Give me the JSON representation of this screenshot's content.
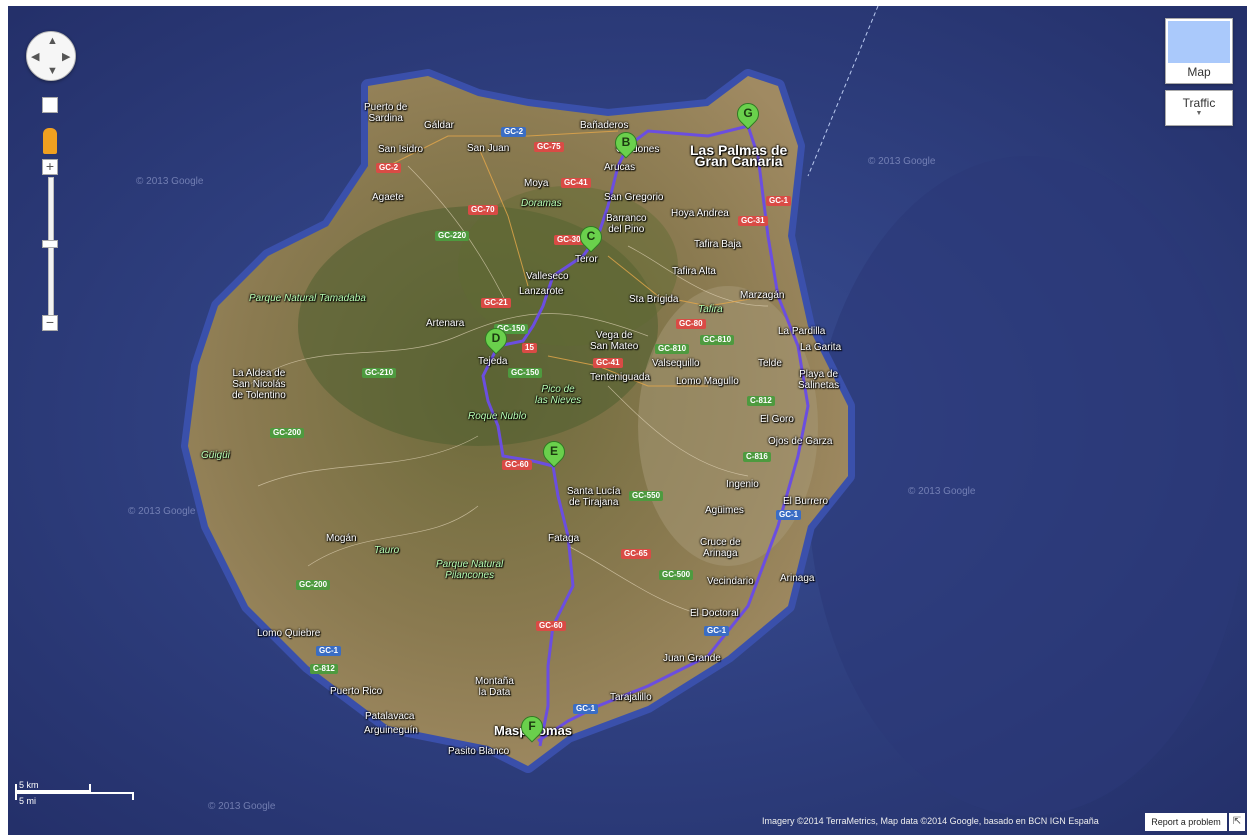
{
  "map_controls": {
    "map_type_label": "Map",
    "traffic_label": "Traffic",
    "zoom_in": "+",
    "zoom_out": "−"
  },
  "scale": {
    "km": "5 km",
    "mi": "5 mi"
  },
  "attribution": "Imagery ©2014 TerraMetrics, Map data ©2014 Google, basado en BCN IGN España",
  "report_label": "Report a problem",
  "watermarks": [
    "© 2013 Google"
  ],
  "waypoints": [
    "B",
    "C",
    "D",
    "E",
    "F",
    "G"
  ],
  "places": {
    "puerto_sardina": "Puerto de\nSardina",
    "galdar": "Gáldar",
    "san_isidro": "San Isidro",
    "san_juan": "San Juan",
    "banaderos": "Bañaderos",
    "cardones": "Cardones",
    "las_palmas": "Las Palmas de\nGran Canaria",
    "arucas": "Arucas",
    "moya": "Moya",
    "doramas": "Doramas",
    "san_gregorio": "San Gregorio",
    "hoya_andrea": "Hoya Andrea",
    "barranco": "Barranco\ndel Pino",
    "agaete": "Agaete",
    "tafira_baja": "Tafira Baja",
    "teror": "Teror",
    "tafira_alta": "Tafira Alta",
    "valleseco": "Valleseco",
    "lanzarote": "Lanzarote",
    "marzagan": "Marzagán",
    "sta_brigida": "Sta Brígida",
    "tafira": "Tafira",
    "tamadaba": "Parque Natural Tamadaba",
    "artenara": "Artenara",
    "la_pardilla": "La Pardilla",
    "vega": "Vega de\nSan Mateo",
    "la_garita": "La Garita",
    "tejeda": "Tejeda",
    "valsequillo": "Valsequillo",
    "telde": "Telde",
    "la_aldea": "La Aldea de\nSan Nicolás\nde Tolentino",
    "tenteniguada": "Tenteniguada",
    "lomo_magullo": "Lomo Magullo",
    "playa": "Playa de\nSalinetas",
    "pico": "Pico de\nlas Nieves",
    "roque": "Roque Nublo",
    "el_goro": "El Goro",
    "ojos": "Ojos de Garza",
    "guigui": "Güigüi",
    "ingenio": "Ingenio",
    "santa_lucia": "Santa Lucía\nde Tirajana",
    "el_burrero": "El Burrero",
    "aguimes": "Agüimes",
    "mogan": "Mogán",
    "tauro": "Tauro",
    "fataga": "Fataga",
    "cruce": "Cruce de\nArinaga",
    "pilancones": "Parque Natural\nPilancones",
    "vecindario": "Vecindario",
    "arinaga": "Arinaga",
    "el_doctoral": "El Doctoral",
    "lomo_quiebre": "Lomo Quiebre",
    "juan_grande": "Juan Grande",
    "montana": "Montaña\nla Data",
    "tarajalillo": "Tarajalillo",
    "puerto_rico": "Puerto Rico",
    "patalavaca": "Patalavaca",
    "arguineguin": "Arguineguín",
    "maspalomas": "Maspalomas",
    "pasito_blanco": "Pasito Blanco"
  },
  "roads": {
    "gc2a": "GC-2",
    "gc75": "GC-75",
    "gc2b": "GC-2",
    "gc41a": "GC-41",
    "gc70": "GC-70",
    "gc220": "GC-220",
    "gc30": "GC-30",
    "gc31": "GC-31",
    "gc1a": "GC-1",
    "gc21": "GC-21",
    "gc150a": "GC-150",
    "gc80": "GC-80",
    "gc810a": "GC-810",
    "gc810b": "GC-810",
    "gc15": "15",
    "gc41b": "GC-41",
    "gc150b": "GC-150",
    "gc210": "GC-210",
    "c812a": "C-812",
    "gc200a": "GC-200",
    "gc60a": "GC-60",
    "c816": "C-816",
    "gc550": "GC-550",
    "gc1b": "GC-1",
    "gc65": "GC-65",
    "gc500": "GC-500",
    "gc200b": "GC-200",
    "gc60b": "GC-60",
    "gc1c": "GC-1",
    "gc1d": "GC-1",
    "c812b": "C-812",
    "gc1e": "GC-1"
  }
}
